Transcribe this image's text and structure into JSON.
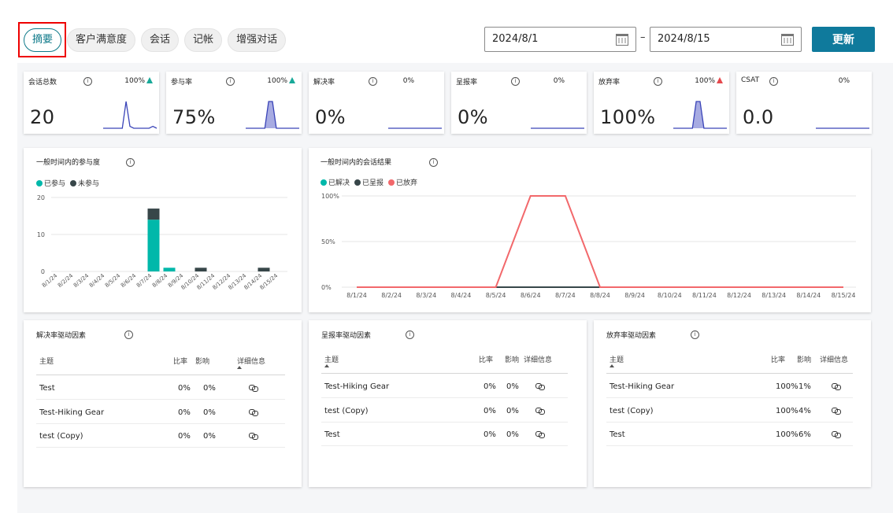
{
  "tabs": [
    {
      "label": "摘要",
      "active": true
    },
    {
      "label": "客户满意度"
    },
    {
      "label": "会话"
    },
    {
      "label": "记帐"
    },
    {
      "label": "增强对话"
    }
  ],
  "date_range": {
    "start": "2024/8/1",
    "separator": "–",
    "end": "2024/8/15"
  },
  "update_button": "更新",
  "info_glyph": "i",
  "kpis": [
    {
      "title": "会话总数",
      "pct": "100%",
      "trend": "up",
      "value": "20"
    },
    {
      "title": "参与率",
      "pct": "100%",
      "trend": "up",
      "value": "75%"
    },
    {
      "title": "解决率",
      "pct": "0%",
      "trend": "none",
      "value": "0%"
    },
    {
      "title": "呈报率",
      "pct": "0%",
      "trend": "none",
      "value": "0%"
    },
    {
      "title": "放弃率",
      "pct": "100%",
      "trend": "up-red",
      "value": "100%"
    },
    {
      "title": "CSAT",
      "pct": "0%",
      "trend": "none",
      "value": "0.0"
    }
  ],
  "engagement_panel": {
    "title": "一般时间内的参与度",
    "legend": [
      "已参与",
      "未参与"
    ]
  },
  "outcome_panel": {
    "title": "一般时间内的会话结果",
    "legend": [
      "已解决",
      "已呈报",
      "已放弃"
    ]
  },
  "colors": {
    "teal": "#01b8aa",
    "dark": "#374649",
    "red": "#f2686b",
    "spark": "#3a44b8",
    "spark_fill": "#a7abe2",
    "accent": "#0f7a9c"
  },
  "chart_data": [
    {
      "type": "bar",
      "stacked": true,
      "categories": [
        "8/1/24",
        "8/2/24",
        "8/3/24",
        "8/4/24",
        "8/5/24",
        "8/6/24",
        "8/7/24",
        "8/8/24",
        "8/9/24",
        "8/10/24",
        "8/11/24",
        "8/12/24",
        "8/13/24",
        "8/14/24",
        "8/15/24"
      ],
      "series": [
        {
          "name": "已参与",
          "values": [
            0,
            0,
            0,
            0,
            0,
            0,
            14,
            1,
            0,
            0,
            0,
            0,
            0,
            0,
            0
          ]
        },
        {
          "name": "未参与",
          "values": [
            0,
            0,
            0,
            0,
            0,
            0,
            3,
            0,
            0,
            1,
            0,
            0,
            0,
            1,
            0
          ]
        }
      ],
      "yticks": [
        0,
        10,
        20
      ],
      "ylim": [
        0,
        20
      ],
      "legend_position": "top-left"
    },
    {
      "type": "line",
      "x": [
        "8/1/24",
        "8/2/24",
        "8/3/24",
        "8/4/24",
        "8/5/24",
        "8/6/24",
        "8/7/24",
        "8/8/24",
        "8/9/24",
        "8/10/24",
        "8/11/24",
        "8/12/24",
        "8/13/24",
        "8/14/24",
        "8/15/24"
      ],
      "series": [
        {
          "name": "已解决",
          "values": [
            0,
            0,
            0,
            0,
            0,
            0,
            0,
            0,
            0,
            0,
            0,
            0,
            0,
            0,
            0
          ]
        },
        {
          "name": "已呈报",
          "values": [
            0,
            0,
            0,
            0,
            0,
            0,
            0,
            0,
            0,
            0,
            0,
            0,
            0,
            0,
            0
          ]
        },
        {
          "name": "已放弃",
          "values": [
            0,
            0,
            0,
            0,
            0,
            100,
            100,
            0,
            0,
            0,
            0,
            0,
            0,
            0,
            0
          ]
        }
      ],
      "yticks": [
        "0%",
        "50%",
        "100%"
      ],
      "ylim": [
        0,
        100
      ],
      "legend_position": "top-left"
    }
  ],
  "sparklines": [
    {
      "values": [
        0,
        0,
        0,
        0,
        0,
        0,
        14,
        1,
        0,
        0,
        0,
        0,
        0,
        1,
        0
      ],
      "style": "line"
    },
    {
      "values": [
        0,
        0,
        0,
        0,
        0,
        0,
        1,
        1,
        0,
        0,
        0,
        0,
        0,
        0,
        0
      ],
      "style": "area"
    },
    {
      "values": [
        0,
        0,
        0,
        0,
        0,
        0,
        0,
        0,
        0,
        0,
        0,
        0,
        0,
        0,
        0
      ],
      "style": "line"
    },
    {
      "values": [
        0,
        0,
        0,
        0,
        0,
        0,
        0,
        0,
        0,
        0,
        0,
        0,
        0,
        0,
        0
      ],
      "style": "line"
    },
    {
      "values": [
        0,
        0,
        0,
        0,
        0,
        0,
        1,
        1,
        0,
        0,
        0,
        0,
        0,
        0,
        0
      ],
      "style": "area"
    },
    {
      "values": [
        0,
        0,
        0,
        0,
        0,
        0,
        0,
        0,
        0,
        0,
        0,
        0,
        0,
        0,
        0
      ],
      "style": "line"
    }
  ],
  "tables": [
    {
      "title": "解决率驱动因素",
      "headers": {
        "topic": "主题",
        "ratio": "比率",
        "impact": "影响",
        "details": "详细信息"
      },
      "rows": [
        {
          "topic": "Test",
          "ratio": "0%",
          "impact": "0%"
        },
        {
          "topic": "Test-Hiking Gear",
          "ratio": "0%",
          "impact": "0%"
        },
        {
          "topic": "test (Copy)",
          "ratio": "0%",
          "impact": "0%"
        }
      ]
    },
    {
      "title": "呈报率驱动因素",
      "headers": {
        "topic": "主题",
        "ratio": "比率",
        "impact": "影响",
        "details": "详细信息"
      },
      "rows": [
        {
          "topic": "Test-Hiking Gear",
          "ratio": "0%",
          "impact": "0%"
        },
        {
          "topic": "test (Copy)",
          "ratio": "0%",
          "impact": "0%"
        },
        {
          "topic": "Test",
          "ratio": "0%",
          "impact": "0%"
        }
      ]
    },
    {
      "title": "放弃率驱动因素",
      "headers": {
        "topic": "主题",
        "ratio": "比率",
        "impact": "影响",
        "details": "详细信息"
      },
      "rows": [
        {
          "topic": "Test-Hiking Gear",
          "ratio": "100%",
          "impact": "1%"
        },
        {
          "topic": "test (Copy)",
          "ratio": "100%",
          "impact": "4%"
        },
        {
          "topic": "Test",
          "ratio": "100%",
          "impact": "6%"
        }
      ]
    }
  ]
}
